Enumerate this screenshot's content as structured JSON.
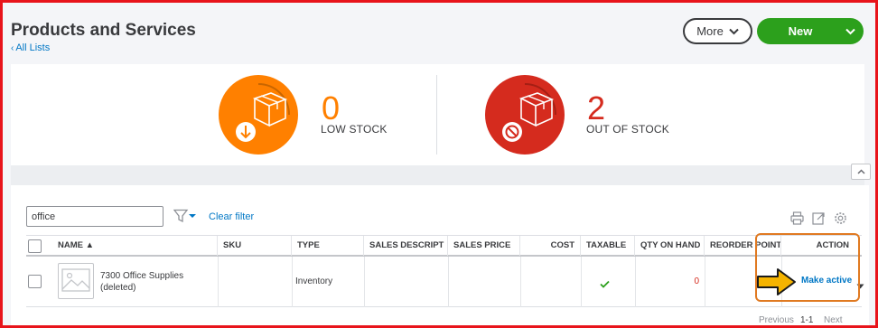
{
  "header": {
    "title": "Products and Services",
    "back_link": "All Lists",
    "more_label": "More",
    "new_label": "New"
  },
  "stock": {
    "low": {
      "count": "0",
      "label": "LOW STOCK",
      "color": "#ff8000"
    },
    "out": {
      "count": "2",
      "label": "OUT OF STOCK",
      "color": "#d52b1e"
    }
  },
  "filter": {
    "search_value": "office",
    "clear_label": "Clear filter"
  },
  "table": {
    "columns": [
      "NAME ▲",
      "SKU",
      "TYPE",
      "SALES DESCRIPT",
      "SALES PRICE",
      "COST",
      "TAXABLE",
      "QTY ON HAND",
      "REORDER POINT",
      "ACTION"
    ],
    "rows": [
      {
        "name": "7300 Office Supplies (deleted)",
        "sku": "",
        "type": "Inventory",
        "sales_description": "",
        "sales_price": "",
        "cost": "",
        "taxable": true,
        "qty_on_hand": "0",
        "reorder_point": "",
        "action": "Make active"
      }
    ]
  },
  "pagination": {
    "previous": "Previous",
    "range": "1-1",
    "next": "Next"
  },
  "colors": {
    "accent_green": "#2ca01c",
    "link_blue": "#0077c5",
    "highlight_orange": "#e07a22",
    "pointer_arrow": "#f5b400"
  }
}
